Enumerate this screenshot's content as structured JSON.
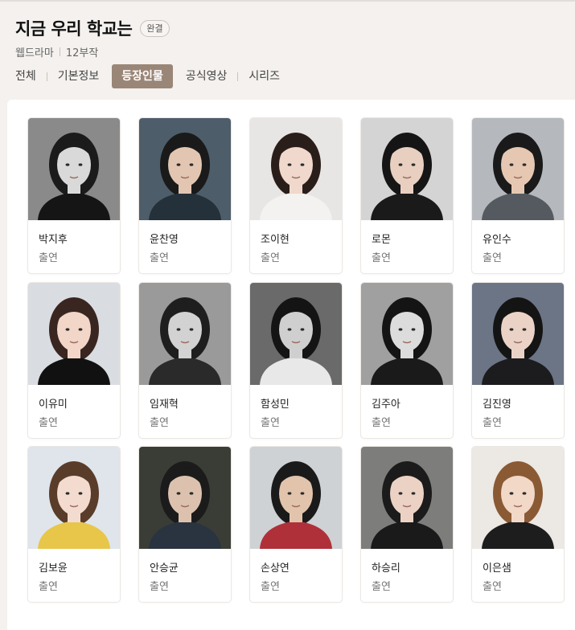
{
  "header": {
    "title": "지금 우리 학교는",
    "badge": "완결",
    "platform": "웹드라마",
    "episodes": "12부작"
  },
  "tabs": [
    {
      "label": "전체",
      "active": false
    },
    {
      "label": "기본정보",
      "active": false
    },
    {
      "label": "등장인물",
      "active": true
    },
    {
      "label": "공식영상",
      "active": false
    },
    {
      "label": "시리즈",
      "active": false
    }
  ],
  "cast": [
    {
      "name": "박지후",
      "role": "출연",
      "bg": "#8a8a8a",
      "hair": "#1b1b1b",
      "skin": "#d9d9d9",
      "top": "#151515"
    },
    {
      "name": "윤찬영",
      "role": "출연",
      "bg": "#4d5d6a",
      "hair": "#1a1a1a",
      "skin": "#e3c6b2",
      "top": "#24303a"
    },
    {
      "name": "조이현",
      "role": "출연",
      "bg": "#e8e6e5",
      "hair": "#2a1e1a",
      "skin": "#f0d8cc",
      "top": "#f4f2f0"
    },
    {
      "name": "로몬",
      "role": "출연",
      "bg": "#d4d4d4",
      "hair": "#151515",
      "skin": "#e8cfc0",
      "top": "#1a1a1a"
    },
    {
      "name": "유인수",
      "role": "출연",
      "bg": "#b5b8bd",
      "hair": "#1a1a1a",
      "skin": "#e6c8b2",
      "top": "#555a60"
    },
    {
      "name": "이유미",
      "role": "출연",
      "bg": "#d9dde2",
      "hair": "#3a2620",
      "skin": "#f2d6c8",
      "top": "#111111"
    },
    {
      "name": "임재혁",
      "role": "출연",
      "bg": "#9a9a9a",
      "hair": "#1e1e1e",
      "skin": "#d2d2d2",
      "top": "#2a2a2a"
    },
    {
      "name": "함성민",
      "role": "출연",
      "bg": "#6a6a6a",
      "hair": "#141414",
      "skin": "#cfcfcf",
      "top": "#e8e8e8"
    },
    {
      "name": "김주아",
      "role": "출연",
      "bg": "#a0a0a0",
      "hair": "#141414",
      "skin": "#dcdcdc",
      "top": "#1a1a1a"
    },
    {
      "name": "김진영",
      "role": "출연",
      "bg": "#6c7585",
      "hair": "#141414",
      "skin": "#ead3c6",
      "top": "#1c1c1f"
    },
    {
      "name": "김보윤",
      "role": "출연",
      "bg": "#dfe5ea",
      "hair": "#5a3c2a",
      "skin": "#f3dccf",
      "top": "#e7c64a"
    },
    {
      "name": "안승균",
      "role": "출연",
      "bg": "#3a3d36",
      "hair": "#1b1b1b",
      "skin": "#dcc2ae",
      "top": "#2a3340"
    },
    {
      "name": "손상연",
      "role": "출연",
      "bg": "#cfd2d4",
      "hair": "#1a1a1a",
      "skin": "#e2c4ac",
      "top": "#b0303a"
    },
    {
      "name": "하승리",
      "role": "출연",
      "bg": "#7d7d7b",
      "hair": "#1b1b1b",
      "skin": "#ecd2c4",
      "top": "#1a1a1a"
    },
    {
      "name": "이은샘",
      "role": "출연",
      "bg": "#ece8e3",
      "hair": "#8a5a34",
      "skin": "#f2d8c7",
      "top": "#1d1d1d"
    }
  ]
}
